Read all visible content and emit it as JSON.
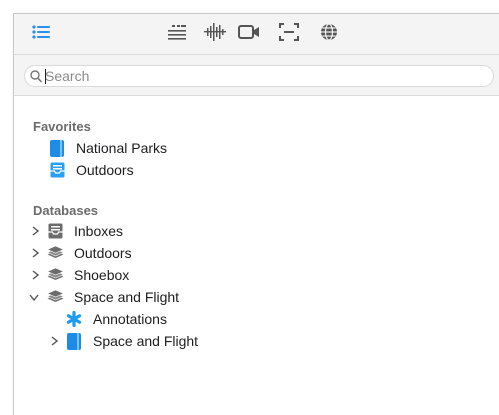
{
  "toolbar": {
    "buttons": [
      "list-icon",
      "text-icon",
      "audio-icon",
      "video-icon",
      "scan-icon",
      "web-icon"
    ],
    "accent": "#2a8ff0"
  },
  "search": {
    "placeholder": "Search",
    "value": ""
  },
  "favorites": {
    "heading": "Favorites",
    "items": [
      {
        "label": "National Parks",
        "icon": "blue-book-icon"
      },
      {
        "label": "Outdoors",
        "icon": "blue-inbox-icon"
      }
    ]
  },
  "databases": {
    "heading": "Databases",
    "items": [
      {
        "label": "Inboxes",
        "icon": "inbox-tray-icon",
        "expanded": false
      },
      {
        "label": "Outdoors",
        "icon": "layers-icon",
        "expanded": false
      },
      {
        "label": "Shoebox",
        "icon": "layers-icon",
        "expanded": false
      },
      {
        "label": "Space and Flight",
        "icon": "layers-icon",
        "expanded": true,
        "children": [
          {
            "label": "Annotations",
            "icon": "asterisk-icon"
          },
          {
            "label": "Space and Flight",
            "icon": "blue-book-icon",
            "expanded": false
          }
        ]
      }
    ]
  }
}
